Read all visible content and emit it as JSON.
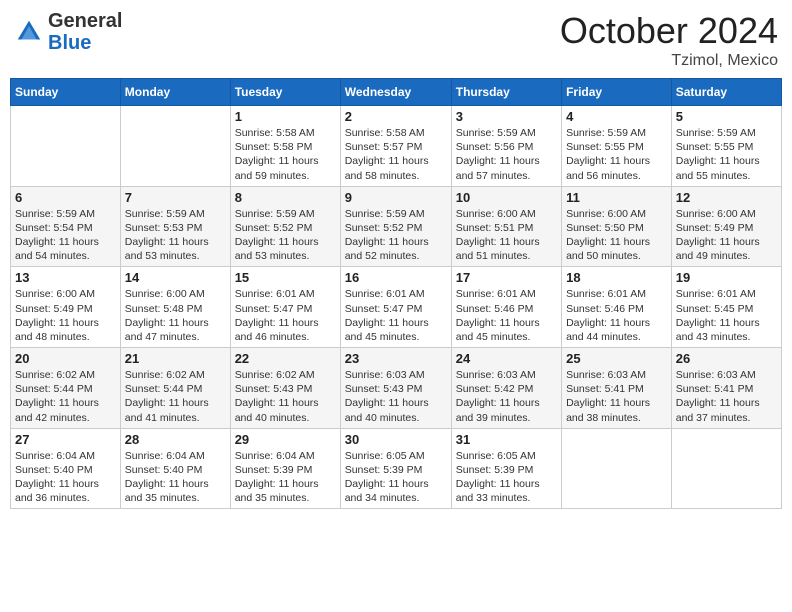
{
  "header": {
    "logo_general": "General",
    "logo_blue": "Blue",
    "title": "October 2024",
    "subtitle": "Tzimol, Mexico"
  },
  "weekdays": [
    "Sunday",
    "Monday",
    "Tuesday",
    "Wednesday",
    "Thursday",
    "Friday",
    "Saturday"
  ],
  "weeks": [
    [
      {
        "day": "",
        "info": ""
      },
      {
        "day": "",
        "info": ""
      },
      {
        "day": "1",
        "info": "Sunrise: 5:58 AM\nSunset: 5:58 PM\nDaylight: 11 hours\nand 59 minutes."
      },
      {
        "day": "2",
        "info": "Sunrise: 5:58 AM\nSunset: 5:57 PM\nDaylight: 11 hours\nand 58 minutes."
      },
      {
        "day": "3",
        "info": "Sunrise: 5:59 AM\nSunset: 5:56 PM\nDaylight: 11 hours\nand 57 minutes."
      },
      {
        "day": "4",
        "info": "Sunrise: 5:59 AM\nSunset: 5:55 PM\nDaylight: 11 hours\nand 56 minutes."
      },
      {
        "day": "5",
        "info": "Sunrise: 5:59 AM\nSunset: 5:55 PM\nDaylight: 11 hours\nand 55 minutes."
      }
    ],
    [
      {
        "day": "6",
        "info": "Sunrise: 5:59 AM\nSunset: 5:54 PM\nDaylight: 11 hours\nand 54 minutes."
      },
      {
        "day": "7",
        "info": "Sunrise: 5:59 AM\nSunset: 5:53 PM\nDaylight: 11 hours\nand 53 minutes."
      },
      {
        "day": "8",
        "info": "Sunrise: 5:59 AM\nSunset: 5:52 PM\nDaylight: 11 hours\nand 53 minutes."
      },
      {
        "day": "9",
        "info": "Sunrise: 5:59 AM\nSunset: 5:52 PM\nDaylight: 11 hours\nand 52 minutes."
      },
      {
        "day": "10",
        "info": "Sunrise: 6:00 AM\nSunset: 5:51 PM\nDaylight: 11 hours\nand 51 minutes."
      },
      {
        "day": "11",
        "info": "Sunrise: 6:00 AM\nSunset: 5:50 PM\nDaylight: 11 hours\nand 50 minutes."
      },
      {
        "day": "12",
        "info": "Sunrise: 6:00 AM\nSunset: 5:49 PM\nDaylight: 11 hours\nand 49 minutes."
      }
    ],
    [
      {
        "day": "13",
        "info": "Sunrise: 6:00 AM\nSunset: 5:49 PM\nDaylight: 11 hours\nand 48 minutes."
      },
      {
        "day": "14",
        "info": "Sunrise: 6:00 AM\nSunset: 5:48 PM\nDaylight: 11 hours\nand 47 minutes."
      },
      {
        "day": "15",
        "info": "Sunrise: 6:01 AM\nSunset: 5:47 PM\nDaylight: 11 hours\nand 46 minutes."
      },
      {
        "day": "16",
        "info": "Sunrise: 6:01 AM\nSunset: 5:47 PM\nDaylight: 11 hours\nand 45 minutes."
      },
      {
        "day": "17",
        "info": "Sunrise: 6:01 AM\nSunset: 5:46 PM\nDaylight: 11 hours\nand 45 minutes."
      },
      {
        "day": "18",
        "info": "Sunrise: 6:01 AM\nSunset: 5:46 PM\nDaylight: 11 hours\nand 44 minutes."
      },
      {
        "day": "19",
        "info": "Sunrise: 6:01 AM\nSunset: 5:45 PM\nDaylight: 11 hours\nand 43 minutes."
      }
    ],
    [
      {
        "day": "20",
        "info": "Sunrise: 6:02 AM\nSunset: 5:44 PM\nDaylight: 11 hours\nand 42 minutes."
      },
      {
        "day": "21",
        "info": "Sunrise: 6:02 AM\nSunset: 5:44 PM\nDaylight: 11 hours\nand 41 minutes."
      },
      {
        "day": "22",
        "info": "Sunrise: 6:02 AM\nSunset: 5:43 PM\nDaylight: 11 hours\nand 40 minutes."
      },
      {
        "day": "23",
        "info": "Sunrise: 6:03 AM\nSunset: 5:43 PM\nDaylight: 11 hours\nand 40 minutes."
      },
      {
        "day": "24",
        "info": "Sunrise: 6:03 AM\nSunset: 5:42 PM\nDaylight: 11 hours\nand 39 minutes."
      },
      {
        "day": "25",
        "info": "Sunrise: 6:03 AM\nSunset: 5:41 PM\nDaylight: 11 hours\nand 38 minutes."
      },
      {
        "day": "26",
        "info": "Sunrise: 6:03 AM\nSunset: 5:41 PM\nDaylight: 11 hours\nand 37 minutes."
      }
    ],
    [
      {
        "day": "27",
        "info": "Sunrise: 6:04 AM\nSunset: 5:40 PM\nDaylight: 11 hours\nand 36 minutes."
      },
      {
        "day": "28",
        "info": "Sunrise: 6:04 AM\nSunset: 5:40 PM\nDaylight: 11 hours\nand 35 minutes."
      },
      {
        "day": "29",
        "info": "Sunrise: 6:04 AM\nSunset: 5:39 PM\nDaylight: 11 hours\nand 35 minutes."
      },
      {
        "day": "30",
        "info": "Sunrise: 6:05 AM\nSunset: 5:39 PM\nDaylight: 11 hours\nand 34 minutes."
      },
      {
        "day": "31",
        "info": "Sunrise: 6:05 AM\nSunset: 5:39 PM\nDaylight: 11 hours\nand 33 minutes."
      },
      {
        "day": "",
        "info": ""
      },
      {
        "day": "",
        "info": ""
      }
    ]
  ]
}
